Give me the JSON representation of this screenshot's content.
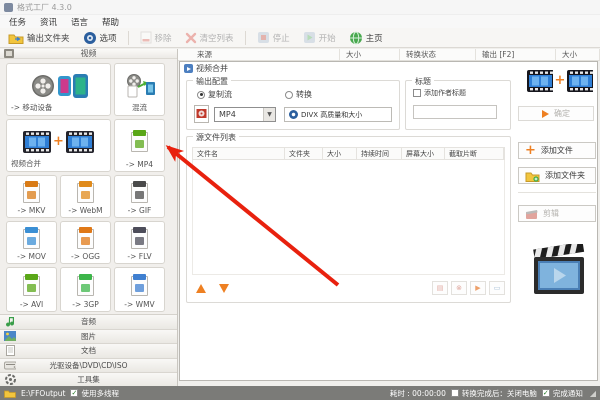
{
  "window": {
    "title": "格式工厂 4.3.0"
  },
  "menu": {
    "items": [
      "任务",
      "资讯",
      "语言",
      "帮助"
    ]
  },
  "toolbar": {
    "output_folder": "输出文件夹",
    "options": "选项",
    "remove": "移除",
    "clear_list": "清空列表",
    "stop": "停止",
    "start": "开始",
    "home": "主页"
  },
  "task_columns": [
    "来源",
    "大小",
    "转换状态",
    "输出 [F2]",
    "大小"
  ],
  "sidebar": {
    "section_video": "视频",
    "cards": [
      {
        "label": "-> 移动设备"
      },
      {
        "label": "混流"
      },
      {
        "label": "视频合并"
      },
      {
        "label": "-> MP4",
        "badge": "#5aa718"
      },
      {
        "label": "-> MKV",
        "badge": "#d97b16"
      },
      {
        "label": "-> WebM",
        "badge": "#e08a1a"
      },
      {
        "label": "-> GIF",
        "badge": "#4a4a4a"
      },
      {
        "label": "-> MOV",
        "badge": "#3b8fd4"
      },
      {
        "label": "-> OGG",
        "badge": "#e07816"
      },
      {
        "label": "-> FLV",
        "badge": "#4d4d5a"
      },
      {
        "label": "-> AVI",
        "badge": "#5aa718"
      },
      {
        "label": "-> 3GP",
        "badge": "#3cb54a"
      },
      {
        "label": "-> WMV",
        "badge": "#3f7fd0"
      }
    ],
    "sections": [
      "音频",
      "图片",
      "文档",
      "光驱设备\\DVD\\CD\\ISO",
      "工具集"
    ]
  },
  "dialog": {
    "title": "视频合并",
    "output_config": {
      "label": "输出配置",
      "radio_copy": "复制流",
      "radio_convert": "转换",
      "format_value": "MP4",
      "quality_button": "DIVX 高质量和大小"
    },
    "title_group": {
      "label": "标题",
      "checkbox": "添加作者标题",
      "input_value": ""
    },
    "file_list": {
      "label": "源文件列表",
      "columns": [
        "文件名",
        "文件夹",
        "大小",
        "持续时间",
        "屏幕大小",
        "截取片断"
      ]
    },
    "buttons": {
      "add_file": "添加文件",
      "add_folder": "添加文件夹",
      "clip": "剪辑",
      "ok": "确定"
    }
  },
  "statusbar": {
    "output_path": "E:\\FFOutput",
    "multithread": "使用多线程",
    "elapsed": "耗时 : 00:00:00",
    "shutdown": "转换完成后：关闭电脑",
    "notify": "完成通知",
    "check_glyph": "✓"
  },
  "colors": {
    "accent_orange": "#ee8022",
    "arrow_red": "#e8210e"
  }
}
